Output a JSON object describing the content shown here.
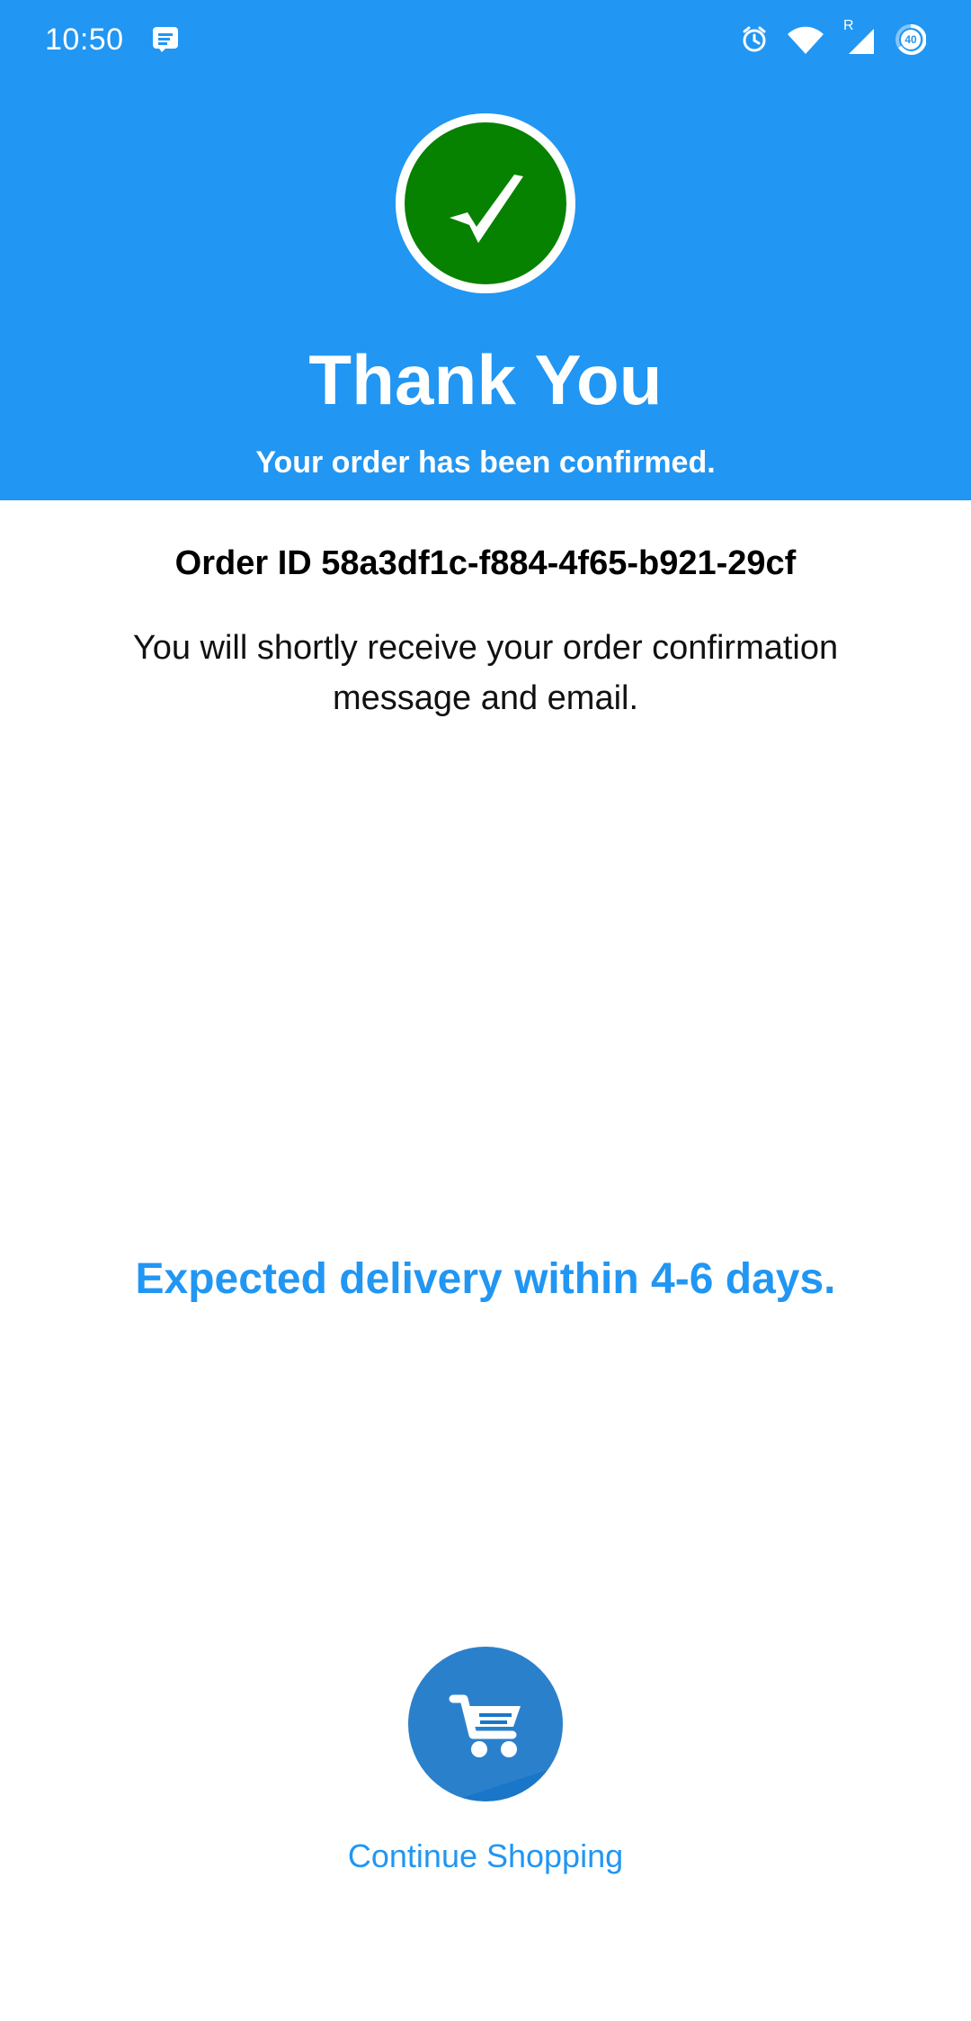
{
  "status_bar": {
    "time": "10:50",
    "icons": [
      "message-icon",
      "alarm-icon",
      "wifi-icon",
      "signal-icon",
      "battery-icon"
    ],
    "roaming_indicator": "R",
    "battery_level": "40"
  },
  "header": {
    "title": "Thank You",
    "subtitle": "Your order has been confirmed.",
    "accent_color": "#2196F3",
    "check_color": "#078100",
    "check_icon": "check-circle-icon"
  },
  "order": {
    "id_label": "Order ID 58a3df1c-f884-4f65-b921-29cf",
    "confirmation_text": "You will shortly receive your order confirmation message and email.",
    "delivery_text": "Expected delivery within 4-6 days."
  },
  "actions": {
    "cart_icon": "shopping-cart-icon",
    "continue_label": "Continue Shopping"
  }
}
